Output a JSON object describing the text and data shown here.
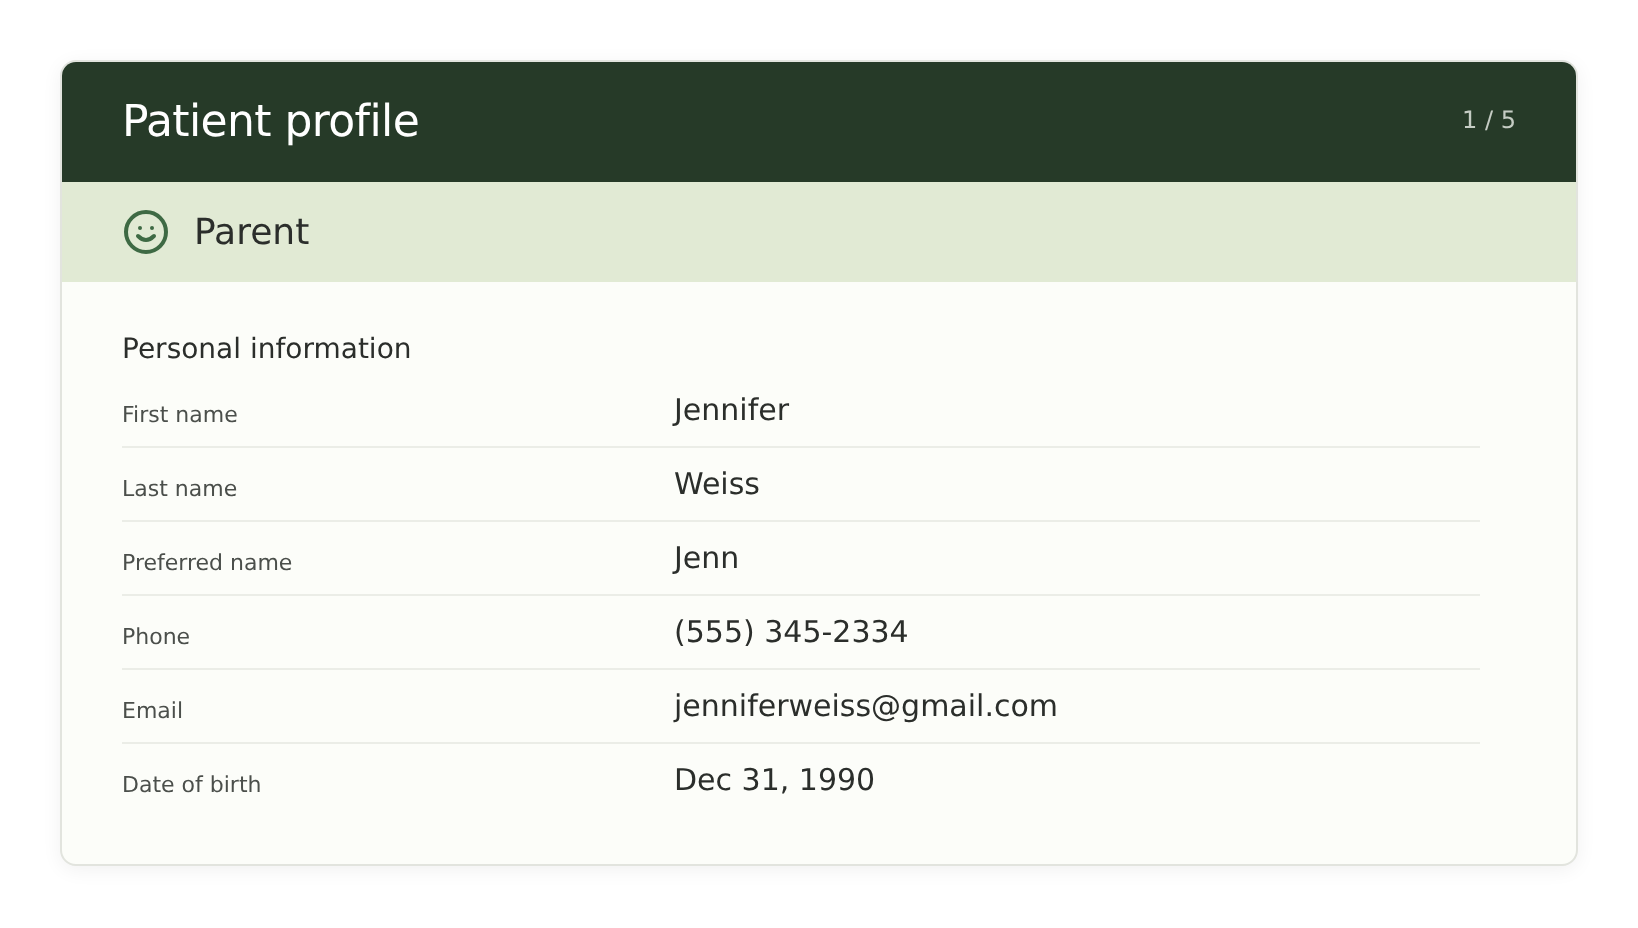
{
  "header": {
    "title": "Patient profile",
    "pager": "1 / 5"
  },
  "role": {
    "label": "Parent"
  },
  "section": {
    "title": "Personal information",
    "fields": [
      {
        "label": "First name",
        "value": "Jennifer"
      },
      {
        "label": "Last name",
        "value": "Weiss"
      },
      {
        "label": "Preferred name",
        "value": "Jenn"
      },
      {
        "label": "Phone",
        "value": "(555) 345-2334"
      },
      {
        "label": "Email",
        "value": "jenniferweiss@gmail.com"
      },
      {
        "label": "Date of birth",
        "value": "Dec 31, 1990"
      }
    ]
  }
}
